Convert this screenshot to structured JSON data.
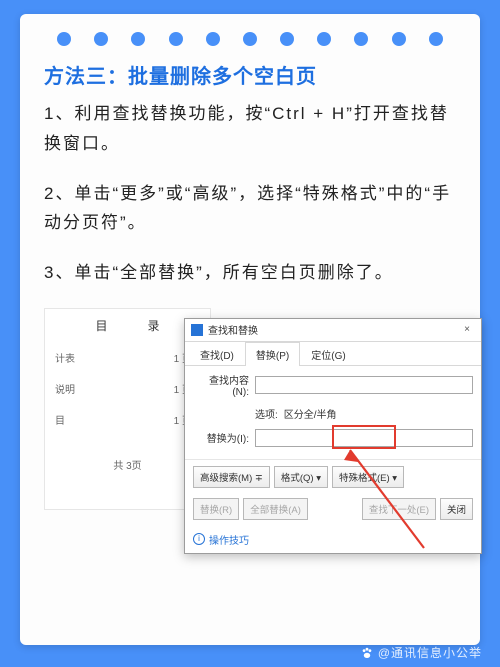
{
  "title": "方法三：批量删除多个空白页",
  "p1": "1、利用查找替换功能，按“Ctrl + H”打开查找替换窗口。",
  "p2": "2、单击“更多”或“高级”，选择“特殊格式”中的“手动分页符”。",
  "p3": "3、单击“全部替换”，所有空白页删除了。",
  "toc": {
    "head": "目　录",
    "rows": [
      {
        "l": "计表",
        "r": "1 页"
      },
      {
        "l": "说明",
        "r": "1 页"
      },
      {
        "l": "目",
        "r": "1 页"
      }
    ],
    "foot": "共  3页"
  },
  "dialog": {
    "title": "查找和替换",
    "close": "×",
    "tabs": {
      "find": "查找(D)",
      "replace": "替换(P)",
      "goto": "定位(G)"
    },
    "find_label": "查找内容(N):",
    "replace_label": "替换为(I):",
    "opt_label": "选项:",
    "opt_value": "区分全/半角",
    "buttons": {
      "more": "高级搜索(M) ∓",
      "format": "格式(Q) ▾",
      "special": "特殊格式(E) ▾",
      "replace": "替换(R)",
      "replace_all": "全部替换(A)",
      "find_next": "查找下一处(E)",
      "close": "关闭"
    },
    "tip": "操作技巧"
  },
  "watermark": "@通讯信息小公举"
}
